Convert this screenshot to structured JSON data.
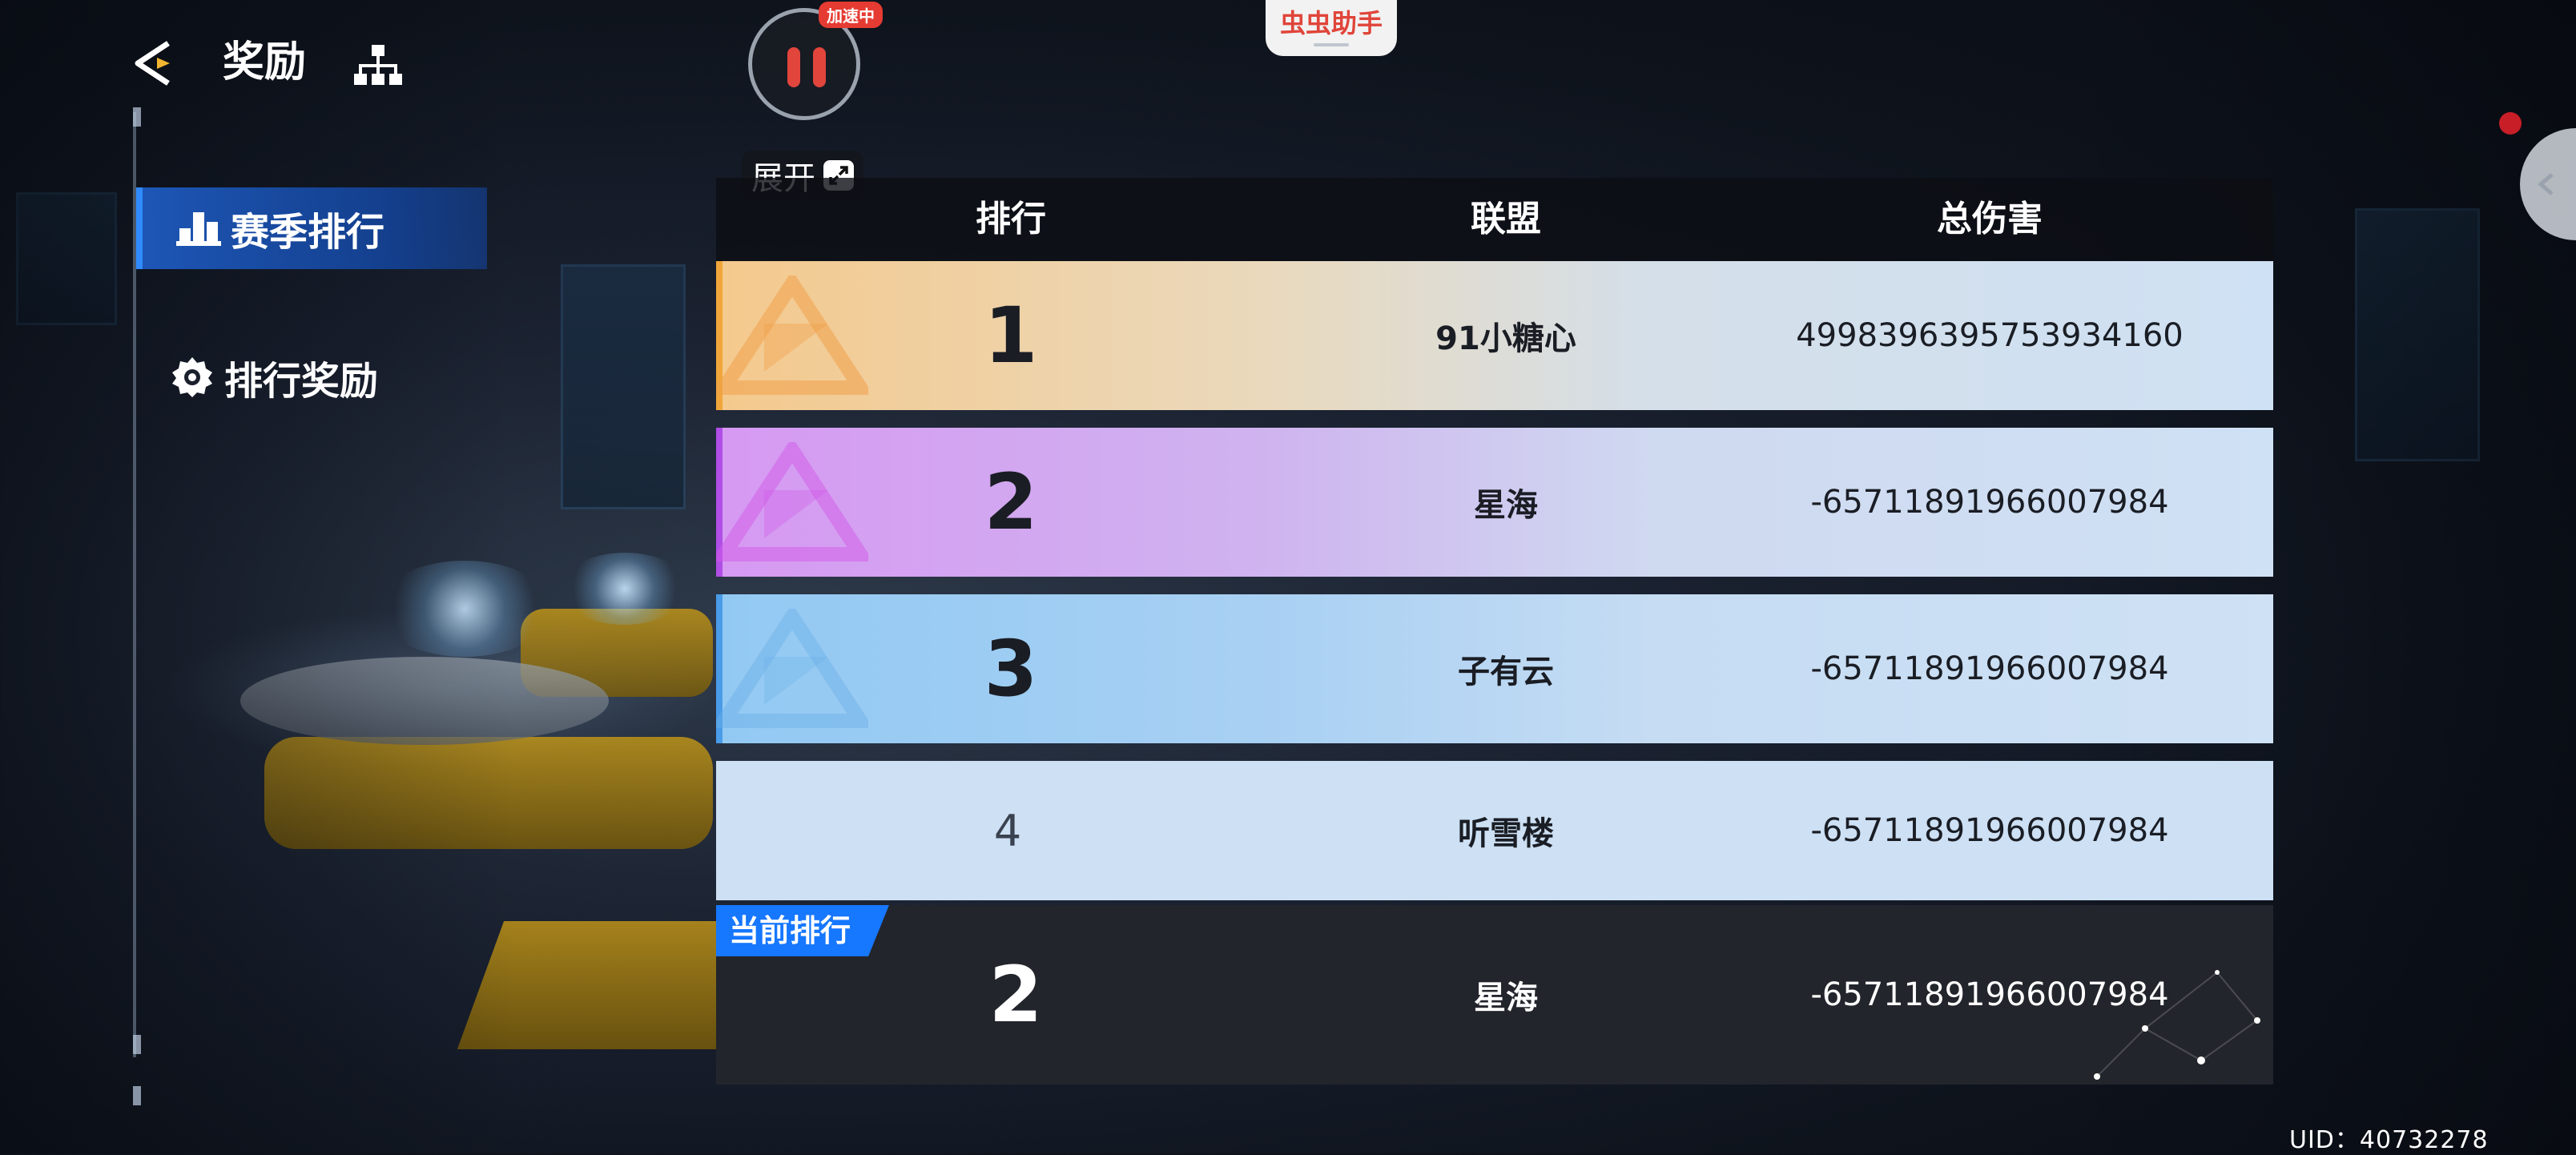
{
  "header": {
    "title": "奖励",
    "back_icon": "back-arrow-icon",
    "tree_icon": "hierarchy-icon"
  },
  "sidebar": {
    "items": [
      {
        "label": "赛季排行",
        "icon": "podium-icon",
        "active": true
      },
      {
        "label": "排行奖励",
        "icon": "gear-badge-icon",
        "active": false
      }
    ]
  },
  "overlay": {
    "speed_badge": "加速中",
    "expand_label": "展开",
    "helper_label": "虫虫助手",
    "uid": "UID：40732278"
  },
  "table": {
    "columns": [
      "排行",
      "联盟",
      "总伤害"
    ],
    "rows": [
      {
        "rank": "1",
        "alliance": "91小糖心",
        "damage": "4998396395753934160"
      },
      {
        "rank": "2",
        "alliance": "星海",
        "damage": "-6571189196600798​4"
      },
      {
        "rank": "3",
        "alliance": "子有云",
        "damage": "-65711891966007984"
      },
      {
        "rank": "4",
        "alliance": "听雪楼",
        "damage": "-65711891966007984"
      }
    ],
    "current": {
      "tag": "当前排行",
      "rank": "2",
      "alliance": "星海",
      "damage": "-65711891966007984"
    }
  },
  "colors": {
    "accent_blue": "#1677ff",
    "rank1_gold": "#f4c98d",
    "rank2_purple": "#d699f2",
    "rank3_blue": "#92c9f3",
    "pause_red": "#e2453c"
  }
}
